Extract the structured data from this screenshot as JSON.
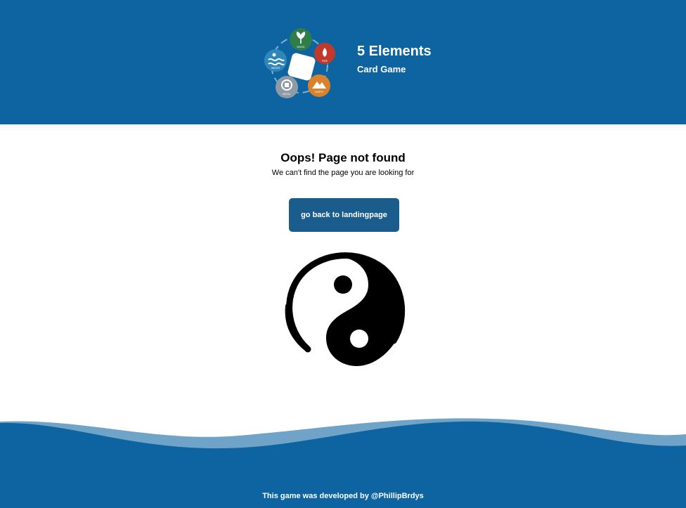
{
  "header": {
    "title": "5 Elements",
    "subtitle": "Card Game",
    "logo_elements": [
      "wood-icon",
      "fire-icon",
      "earth-icon",
      "metal-icon",
      "water-icon"
    ],
    "logo_labels": [
      "WOOD",
      "FIRE",
      "EARTH",
      "METAL",
      "WATER"
    ]
  },
  "main": {
    "error_title": "Oops! Page not found",
    "error_text": "We can't find the page you are looking for",
    "back_button_label": "go back to landingpage",
    "illustration_icon": "yin-yang-icon"
  },
  "footer": {
    "credit": "This game was developed by @PhillipBrdys"
  },
  "colors": {
    "brand_blue": "#0d64a1",
    "button_blue": "#1a5c8b",
    "wave_light": "#6fa3c8",
    "wood": "#2e7d4a",
    "fire": "#c0392b",
    "earth": "#d9822b",
    "metal": "#8e9aa6",
    "water": "#2f86b8"
  }
}
